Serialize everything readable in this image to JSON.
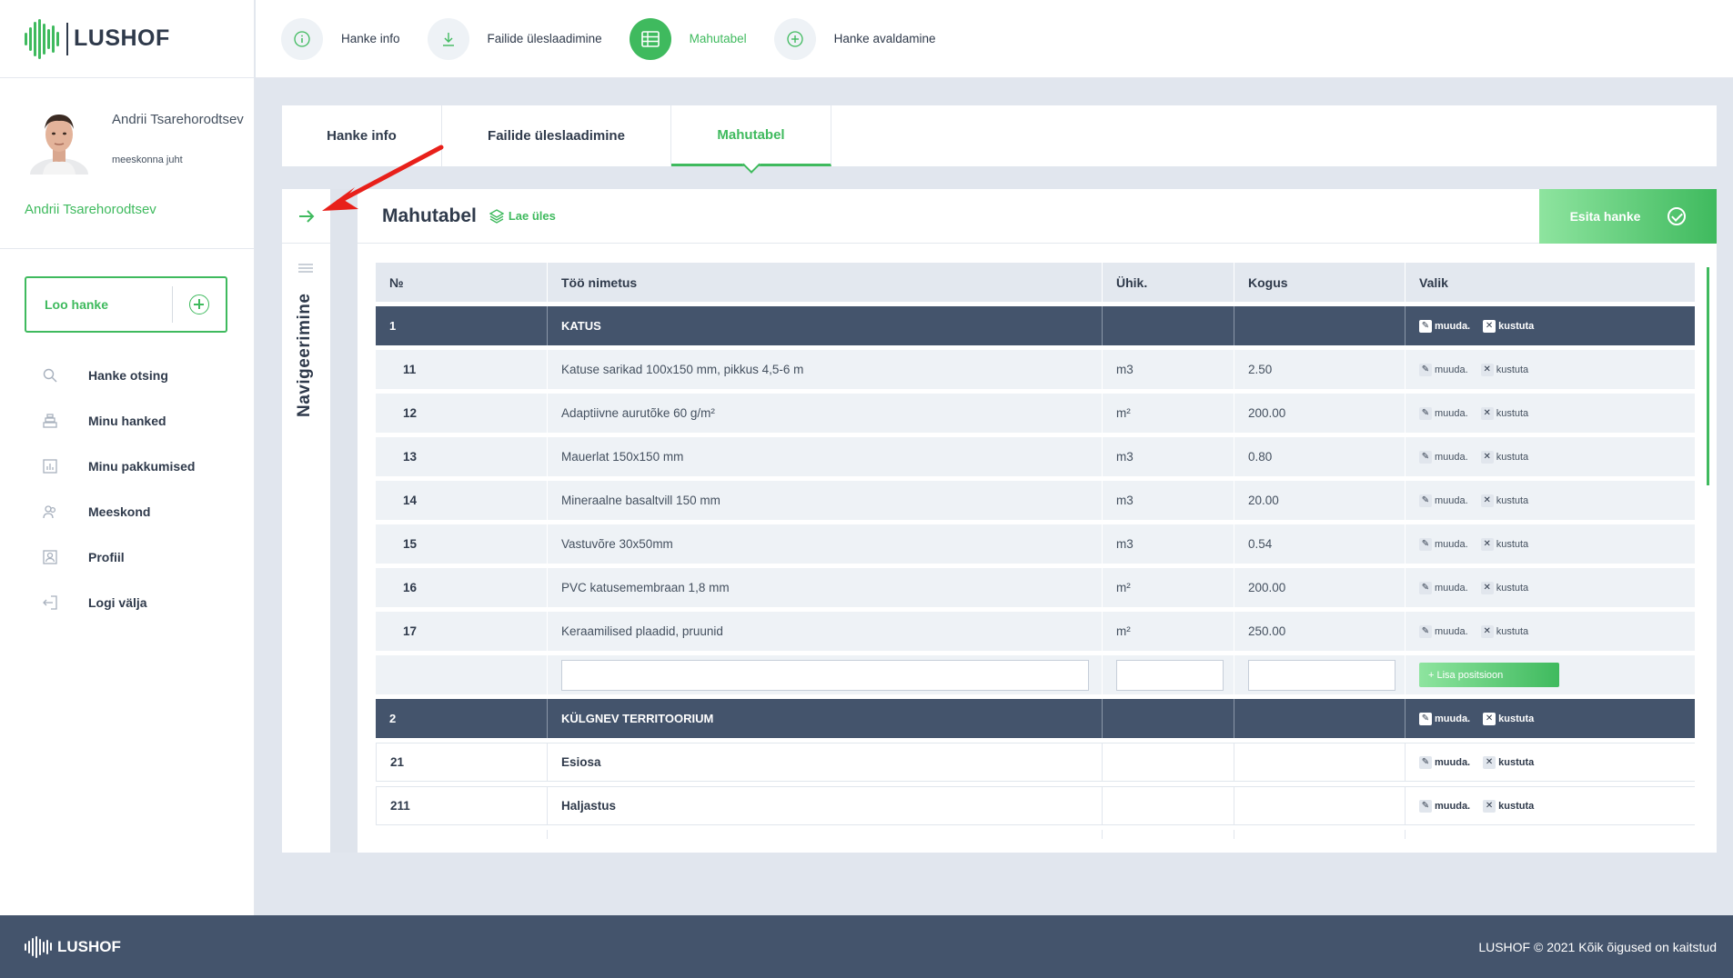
{
  "brand": {
    "name": "LUSHOF"
  },
  "profile": {
    "name": "Andrii Tsarehorodtsev",
    "role": "meeskonna juht",
    "link": "Andrii Tsarehorodtsev"
  },
  "sidebar": {
    "create_label": "Loo hanke",
    "items": [
      {
        "label": "Hanke otsing",
        "icon": "search-icon"
      },
      {
        "label": "Minu hanked",
        "icon": "stack-icon"
      },
      {
        "label": "Minu pakkumised",
        "icon": "chart-icon"
      },
      {
        "label": "Meeskond",
        "icon": "team-icon"
      },
      {
        "label": "Profiil",
        "icon": "profile-icon"
      },
      {
        "label": "Logi välja",
        "icon": "logout-icon"
      }
    ]
  },
  "steps": [
    {
      "label": "Hanke info",
      "icon": "info-icon"
    },
    {
      "label": "Failide üleslaadimine",
      "icon": "download-icon"
    },
    {
      "label": "Mahutabel",
      "icon": "table-icon",
      "active": true
    },
    {
      "label": "Hanke avaldamine",
      "icon": "plus-circle-icon"
    }
  ],
  "tabs": [
    {
      "label": "Hanke info"
    },
    {
      "label": "Failide üleslaadimine"
    },
    {
      "label": "Mahutabel",
      "active": true
    }
  ],
  "nav_strip": {
    "label": "Navigeerimine"
  },
  "main": {
    "title": "Mahutabel",
    "upload_label": "Lae üles",
    "submit_label": "Esita hanke",
    "columns": [
      "№",
      "Töö nimetus",
      "Ühik.",
      "Kogus",
      "Valik"
    ],
    "edit_label": "muuda.",
    "delete_label": "kustuta",
    "add_position_label": "+ Lisa positsioon",
    "groups": [
      {
        "no": "1",
        "name": "KATUS",
        "items": [
          {
            "no": "11",
            "name": "Katuse sarikad 100x150 mm, pikkus 4,5-6 m",
            "unit": "m3",
            "qty": "2.50"
          },
          {
            "no": "12",
            "name": "Adaptiivne aurutõke 60 g/m²",
            "unit": "m²",
            "qty": "200.00"
          },
          {
            "no": "13",
            "name": "Mauerlat 150x150 mm",
            "unit": "m3",
            "qty": "0.80"
          },
          {
            "no": "14",
            "name": "Mineraalne basaltvill 150 mm",
            "unit": "m3",
            "qty": "20.00"
          },
          {
            "no": "15",
            "name": "Vastuvõre 30x50mm",
            "unit": "m3",
            "qty": "0.54"
          },
          {
            "no": "16",
            "name": "PVC katusemembraan 1,8 mm",
            "unit": "m²",
            "qty": "200.00"
          },
          {
            "no": "17",
            "name": "Keraamilised plaadid, pruunid",
            "unit": "m²",
            "qty": "250.00"
          }
        ]
      },
      {
        "no": "2",
        "name": "KÜLGNEV TERRITOORIUM",
        "subs": [
          {
            "no": "21",
            "name": "Esiosa"
          },
          {
            "no": "211",
            "name": "Haljastus"
          }
        ]
      }
    ]
  },
  "footer": {
    "brand": "LUSHOF",
    "copyright": "LUSHOF © 2021 Kõik õigused on kaitstud"
  },
  "colors": {
    "accent": "#3fba5e",
    "dark": "#44546c",
    "annotation": "#e8201a"
  }
}
